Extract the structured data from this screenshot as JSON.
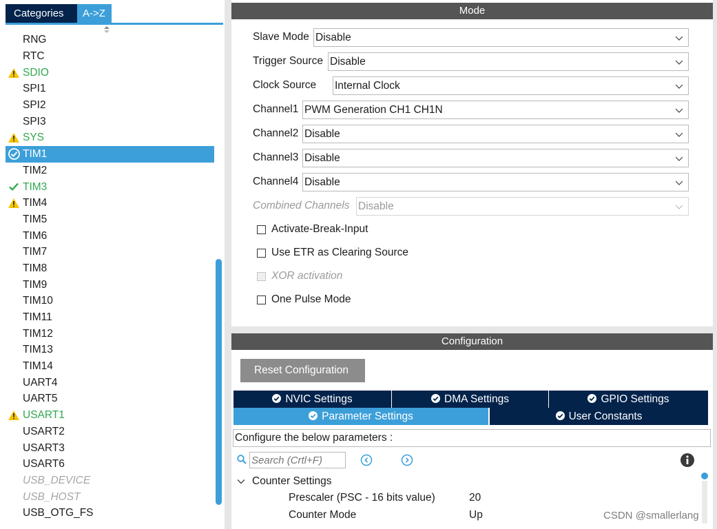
{
  "left_panel": {
    "tabs": [
      {
        "label": "Categories"
      },
      {
        "label": "A->Z"
      }
    ],
    "items": [
      {
        "label": "RNG",
        "status": "none"
      },
      {
        "label": "RTC",
        "status": "none"
      },
      {
        "label": "SDIO",
        "status": "warning"
      },
      {
        "label": "SPI1",
        "status": "none"
      },
      {
        "label": "SPI2",
        "status": "none"
      },
      {
        "label": "SPI3",
        "status": "none"
      },
      {
        "label": "SYS",
        "status": "warning"
      },
      {
        "label": "TIM1",
        "status": "selected"
      },
      {
        "label": "TIM2",
        "status": "none"
      },
      {
        "label": "TIM3",
        "status": "ok"
      },
      {
        "label": "TIM4",
        "status": "warning-black"
      },
      {
        "label": "TIM5",
        "status": "none"
      },
      {
        "label": "TIM6",
        "status": "none"
      },
      {
        "label": "TIM7",
        "status": "none"
      },
      {
        "label": "TIM8",
        "status": "none"
      },
      {
        "label": "TIM9",
        "status": "none"
      },
      {
        "label": "TIM10",
        "status": "none"
      },
      {
        "label": "TIM11",
        "status": "none"
      },
      {
        "label": "TIM12",
        "status": "none"
      },
      {
        "label": "TIM13",
        "status": "none"
      },
      {
        "label": "TIM14",
        "status": "none"
      },
      {
        "label": "UART4",
        "status": "none"
      },
      {
        "label": "UART5",
        "status": "none"
      },
      {
        "label": "USART1",
        "status": "warning"
      },
      {
        "label": "USART2",
        "status": "none"
      },
      {
        "label": "USART3",
        "status": "none"
      },
      {
        "label": "USART6",
        "status": "none"
      },
      {
        "label": "USB_DEVICE",
        "status": "disabled"
      },
      {
        "label": "USB_HOST",
        "status": "disabled"
      },
      {
        "label": "USB_OTG_FS",
        "status": "none"
      }
    ]
  },
  "mode": {
    "header": "Mode",
    "fields": [
      {
        "label": "Slave Mode",
        "value": "Disable",
        "enabled": true
      },
      {
        "label": "Trigger Source",
        "value": "Disable",
        "enabled": true
      },
      {
        "label": "Clock Source",
        "value": "Internal Clock",
        "enabled": true
      },
      {
        "label": "Channel1",
        "value": "PWM Generation CH1 CH1N",
        "enabled": true
      },
      {
        "label": "Channel2",
        "value": "Disable",
        "enabled": true
      },
      {
        "label": "Channel3",
        "value": "Disable",
        "enabled": true
      },
      {
        "label": "Channel4",
        "value": "Disable",
        "enabled": true
      },
      {
        "label": "Combined Channels",
        "value": "Disable",
        "enabled": false
      }
    ],
    "checkboxes": [
      {
        "label": "Activate-Break-Input",
        "checked": false,
        "enabled": true
      },
      {
        "label": "Use ETR as Clearing Source",
        "checked": false,
        "enabled": true
      },
      {
        "label": "XOR activation",
        "checked": false,
        "enabled": false
      },
      {
        "label": "One Pulse Mode",
        "checked": false,
        "enabled": true
      }
    ]
  },
  "configuration": {
    "header": "Configuration",
    "reset_label": "Reset Configuration",
    "tabs": [
      {
        "label": "NVIC Settings",
        "active": false
      },
      {
        "label": "DMA Settings",
        "active": false
      },
      {
        "label": "GPIO Settings",
        "active": false
      },
      {
        "label": "Parameter Settings",
        "active": true
      },
      {
        "label": "User Constants",
        "active": false
      }
    ],
    "description": "Configure the below parameters :",
    "search_placeholder": "Search (Crtl+F)",
    "group": "Counter Settings",
    "params": [
      {
        "name": "Prescaler (PSC - 16 bits value)",
        "value": "20"
      },
      {
        "name": "Counter Mode",
        "value": "Up"
      }
    ]
  },
  "watermark": "CSDN @smallerlang",
  "colors": {
    "accent": "#3c9fd9",
    "navy": "#03234b",
    "header_gray": "#555555",
    "button_gray": "#8c8c8c",
    "ok_green": "#2fa84f",
    "warning_yellow": "#f5c400"
  }
}
